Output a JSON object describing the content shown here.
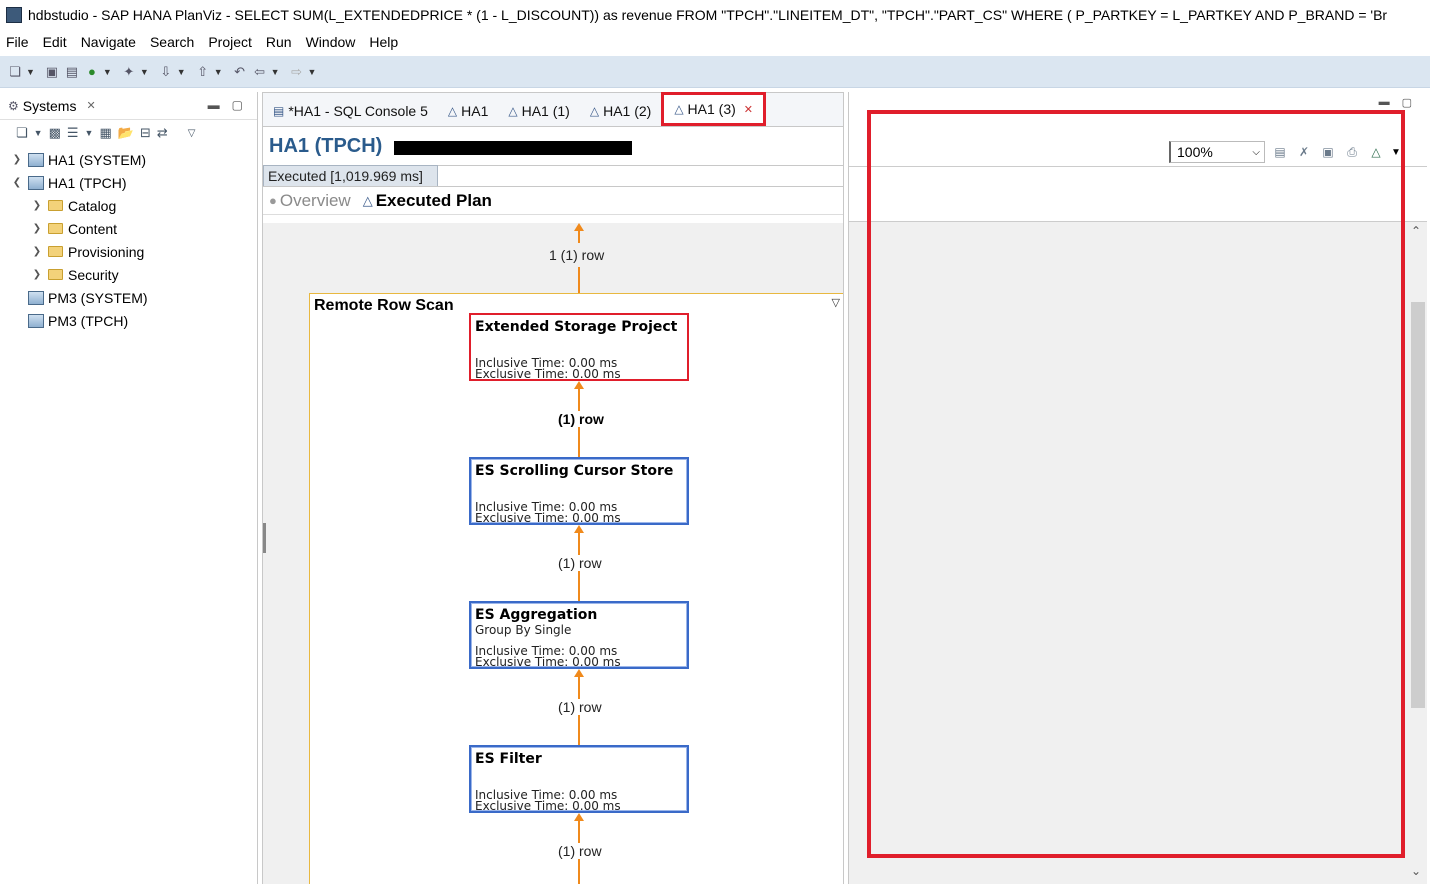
{
  "window": {
    "title": "hdbstudio - SAP HANA PlanViz - SELECT   SUM(L_EXTENDEDPRICE * (1 - L_DISCOUNT)) as revenue FROM   \"TPCH\".\"LINEITEM_DT\",   \"TPCH\".\"PART_CS\" WHERE   (     P_PARTKEY = L_PARTKEY     AND P_BRAND = 'Br"
  },
  "menu": [
    "File",
    "Edit",
    "Navigate",
    "Search",
    "Project",
    "Run",
    "Window",
    "Help"
  ],
  "systems_panel": {
    "tab_label": "Systems",
    "tree": [
      {
        "label": "HA1 (SYSTEM)",
        "expanded": false
      },
      {
        "label": "HA1 (TPCH)",
        "expanded": true
      },
      {
        "label": "Catalog"
      },
      {
        "label": "Content"
      },
      {
        "label": "Provisioning"
      },
      {
        "label": "Security"
      },
      {
        "label": "PM3 (SYSTEM)"
      },
      {
        "label": "PM3 (TPCH)"
      }
    ]
  },
  "editor": {
    "tabs": [
      {
        "label": "*HA1 - SQL Console 5",
        "icon": "sql-icon",
        "active": false
      },
      {
        "label": "HA1",
        "icon": "plan-icon",
        "active": false
      },
      {
        "label": "HA1 (1)",
        "icon": "plan-icon",
        "active": false
      },
      {
        "label": "HA1 (2)",
        "icon": "plan-icon",
        "active": false
      },
      {
        "label": "HA1 (3)",
        "icon": "plan-icon",
        "active": true
      }
    ],
    "title": "HA1 (TPCH)",
    "executed_tab": "Executed [1,019.969 ms]",
    "view_tabs": {
      "overview": "Overview",
      "executed_plan": "Executed Plan"
    },
    "plan": {
      "top_row_label": "1 (1) row",
      "group_title": "Remote Row Scan",
      "nodes": [
        {
          "title": "Extended Storage Project",
          "subtitle": "",
          "inclusive": "Inclusive Time: 0.00 ms",
          "exclusive": "Exclusive Time: 0.00 ms"
        },
        {
          "title": "ES Scrolling Cursor Store",
          "subtitle": "",
          "inclusive": "Inclusive Time: 0.00 ms",
          "exclusive": "Exclusive Time: 0.00 ms"
        },
        {
          "title": "ES Aggregation",
          "subtitle": "Group By Single",
          "inclusive": "Inclusive Time: 0.00 ms",
          "exclusive": "Exclusive Time: 0.00 ms"
        },
        {
          "title": "ES Filter",
          "subtitle": "",
          "inclusive": "Inclusive Time: 0.00 ms",
          "exclusive": "Exclusive Time: 0.00 ms"
        }
      ],
      "edge_labels": [
        "(1) row",
        "(1) row",
        "(1) row",
        "(1) row"
      ]
    }
  },
  "properties_panel": {
    "zoom": "100%"
  },
  "colors": {
    "highlight_red": "#e01e2b",
    "edge_orange": "#f08a1c",
    "node_blue": "#3a6ac8",
    "title_blue": "#2a5b8c"
  }
}
